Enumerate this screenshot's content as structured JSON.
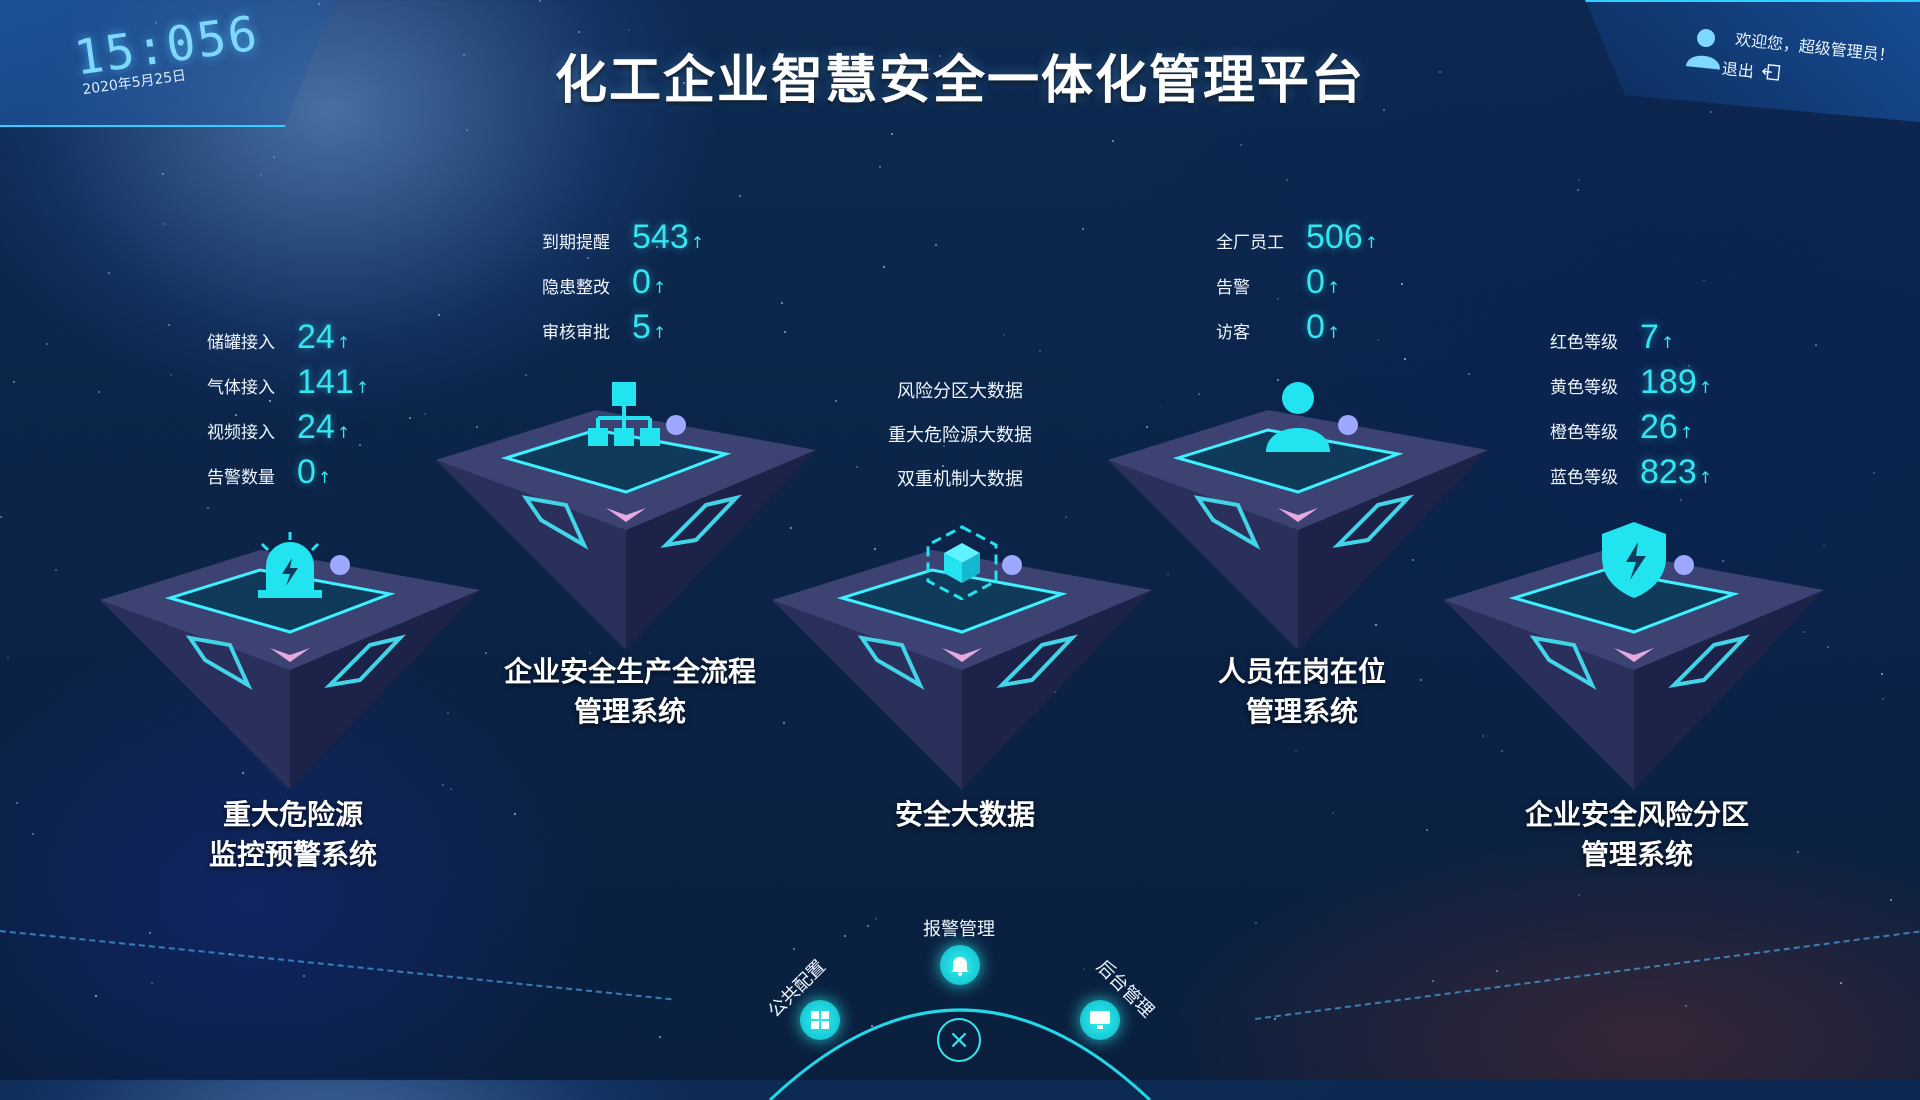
{
  "header": {
    "title": "化工企业智慧安全一体化管理平台",
    "clock_time": "15:056",
    "clock_date": "2020年5月25日",
    "welcome": "欢迎您，超级管理员！",
    "logout_label": "退出"
  },
  "stats": {
    "tank": {
      "rows": [
        {
          "label": "储罐接入",
          "value": "24"
        },
        {
          "label": "气体接入",
          "value": "141"
        },
        {
          "label": "视频接入",
          "value": "24"
        },
        {
          "label": "告警数量",
          "value": "0"
        }
      ]
    },
    "process": {
      "rows": [
        {
          "label": "到期提醒",
          "value": "543"
        },
        {
          "label": "隐患整改",
          "value": "0"
        },
        {
          "label": "审核审批",
          "value": "5"
        }
      ]
    },
    "bigdata": {
      "items": [
        "风险分区大数据",
        "重大危险源大数据",
        "双重机制大数据"
      ]
    },
    "personnel": {
      "rows": [
        {
          "label": "全厂员工",
          "value": "506"
        },
        {
          "label": "告警",
          "value": "0"
        },
        {
          "label": "访客",
          "value": "0"
        }
      ]
    },
    "risk": {
      "rows": [
        {
          "label": "红色等级",
          "value": "7"
        },
        {
          "label": "黄色等级",
          "value": "189"
        },
        {
          "label": "橙色等级",
          "value": "26"
        },
        {
          "label": "蓝色等级",
          "value": "823"
        }
      ]
    },
    "arrow": "↑"
  },
  "modules": [
    {
      "name_line1": "重大危险源",
      "name_line2": "监控预警系统",
      "icon": "alarm-light-icon"
    },
    {
      "name_line1": "企业安全生产全流程",
      "name_line2": "管理系统",
      "icon": "flowchart-icon"
    },
    {
      "name_line1": "安全大数据",
      "name_line2": "",
      "icon": "cube-icon"
    },
    {
      "name_line1": "人员在岗在位",
      "name_line2": "管理系统",
      "icon": "person-icon"
    },
    {
      "name_line1": "企业安全风险分区",
      "name_line2": "管理系统",
      "icon": "shield-icon"
    }
  ],
  "nav": {
    "public_config": "公共配置",
    "alarm_manage": "报警管理",
    "backend_manage": "后台管理"
  },
  "colors": {
    "accent": "#34e6f2",
    "background": "#0b2448"
  }
}
